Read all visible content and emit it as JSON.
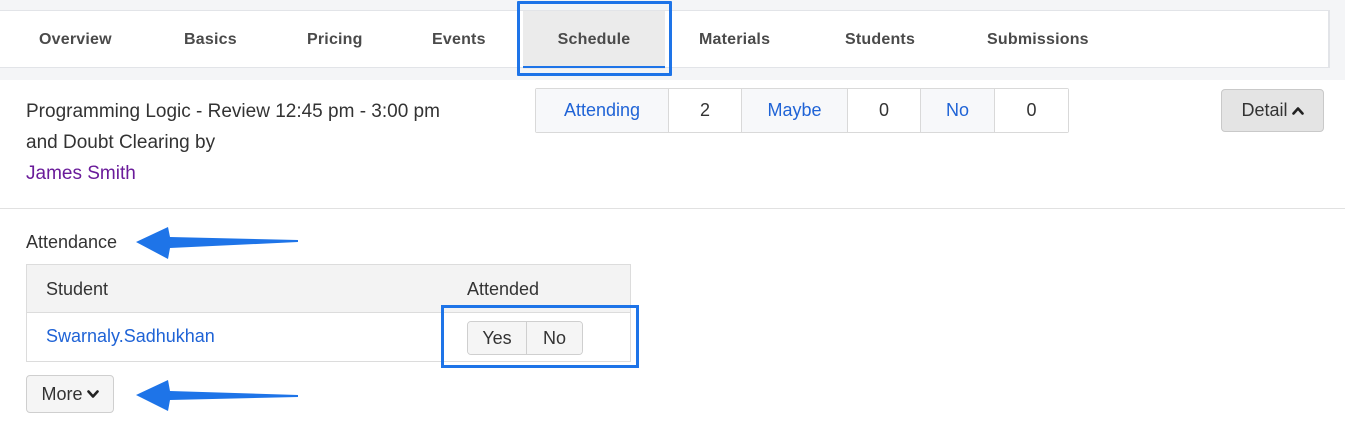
{
  "tabs": [
    {
      "label": "Overview",
      "active": false
    },
    {
      "label": "Basics",
      "active": false
    },
    {
      "label": "Pricing",
      "active": false
    },
    {
      "label": "Events",
      "active": false
    },
    {
      "label": "Schedule",
      "active": true
    },
    {
      "label": "Materials",
      "active": false
    },
    {
      "label": "Students",
      "active": false
    },
    {
      "label": "Submissions",
      "active": false
    }
  ],
  "event": {
    "title_line1": "Programming Logic - Review 12:45 pm - 3:00 pm",
    "title_line2": "and Doubt Clearing by",
    "host": "James Smith"
  },
  "rsvp": {
    "attending_label": "Attending",
    "attending_count": "2",
    "maybe_label": "Maybe",
    "maybe_count": "0",
    "no_label": "No",
    "no_count": "0"
  },
  "detail_button": {
    "label": "Detail",
    "icon": "chevron-up-icon"
  },
  "attendance": {
    "title": "Attendance",
    "col_student": "Student",
    "col_attended": "Attended",
    "rows": [
      {
        "student": "Swarnaly.Sadhukhan",
        "yes_label": "Yes",
        "no_label": "No"
      }
    ]
  },
  "more_button": {
    "label": "More",
    "icon": "chevron-down-icon"
  },
  "colors": {
    "accent": "#1e74e8",
    "link": "#1f63d6",
    "host": "#6a1b9a"
  }
}
